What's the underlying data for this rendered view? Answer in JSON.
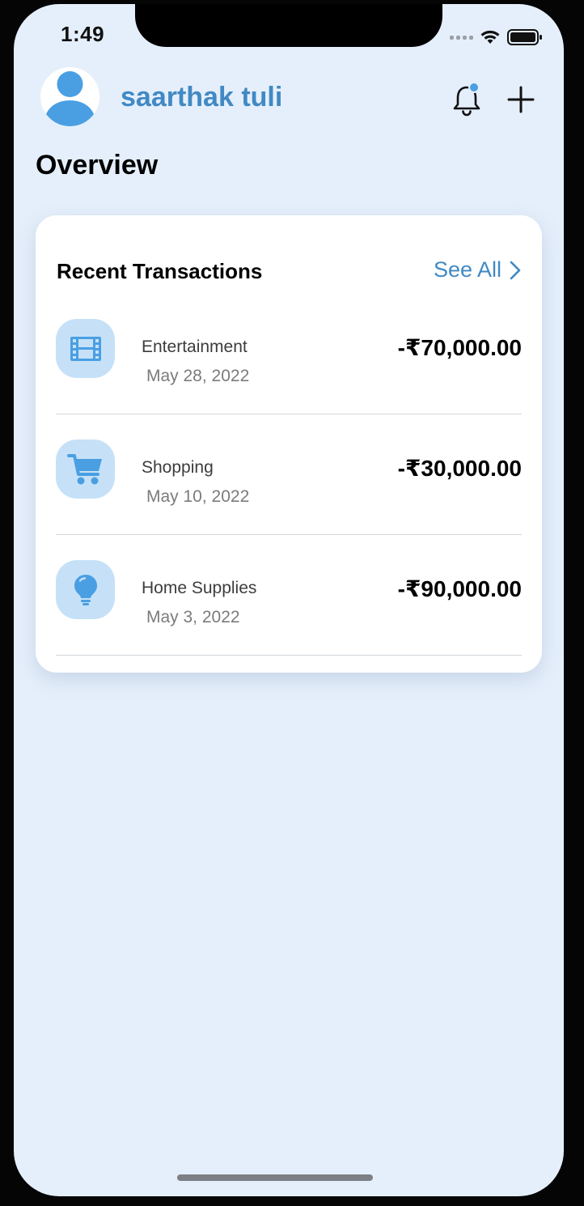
{
  "status_bar": {
    "time": "1:49"
  },
  "header": {
    "user_name": "saarthak tuli",
    "avatar_icon": "person-icon",
    "bell_icon": "bell-icon",
    "add_icon": "plus-icon"
  },
  "overview": {
    "title": "Overview"
  },
  "recent_transactions": {
    "title": "Recent Transactions",
    "see_all_label": "See All",
    "items": [
      {
        "category": "Entertainment",
        "date": "May 28, 2022",
        "amount": "-₹70,000.00",
        "icon": "film-icon"
      },
      {
        "category": "Shopping",
        "date": "May 10, 2022",
        "amount": "-₹30,000.00",
        "icon": "cart-icon"
      },
      {
        "category": "Home Supplies",
        "date": "May 3, 2022",
        "amount": "-₹90,000.00",
        "icon": "lightbulb-icon"
      }
    ]
  },
  "colors": {
    "background": "#e5effb",
    "accent": "#4189c4",
    "icon_tile": "#c6e1f7",
    "icon_fill": "#4a9fe3",
    "notification_dot": "#4a9fe3"
  }
}
